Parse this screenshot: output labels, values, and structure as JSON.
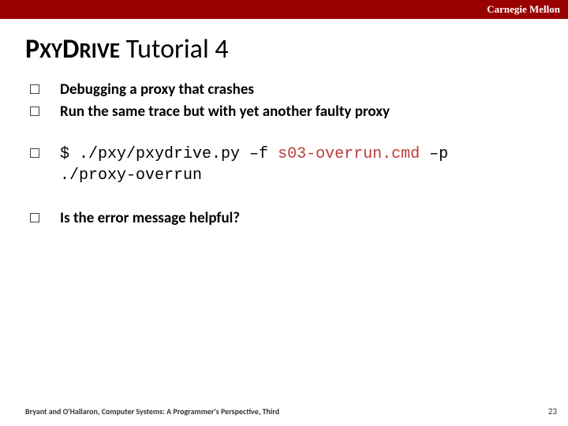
{
  "header": {
    "university": "Carnegie Mellon"
  },
  "title": {
    "p": "P",
    "xy": "XY",
    "d": "D",
    "rive": "RIVE",
    "rest": " Tutorial 4"
  },
  "bullets": {
    "line1": "Debugging a proxy that crashes",
    "line2": "Run the same trace but with yet another faulty proxy",
    "cmd_prompt": "$ ",
    "cmd_part1": "./pxy/pxydrive.py –f ",
    "cmd_file": "s03-overrun.cmd",
    "cmd_part2a": " –p ",
    "cmd_part2b": "./proxy-overrun",
    "line4": "Is the error message helpful?"
  },
  "footer": {
    "left": "Bryant and O'Hallaron, Computer Systems: A Programmer's Perspective, Third",
    "page": "23"
  }
}
